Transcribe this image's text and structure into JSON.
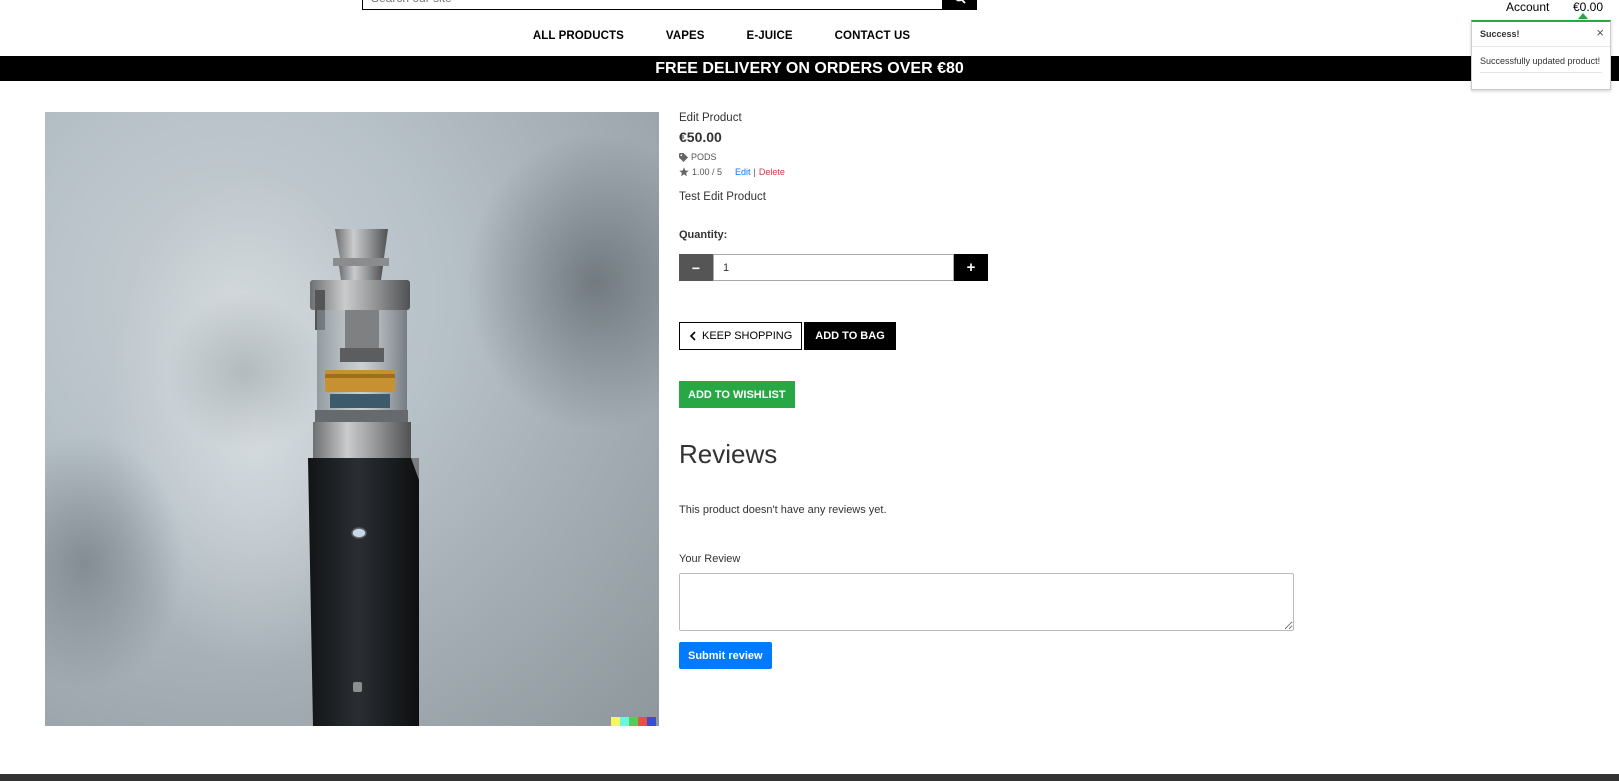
{
  "header": {
    "search_placeholder": "Search our site",
    "account_label": "Account",
    "cart_total": "€0.00"
  },
  "nav": {
    "items": [
      {
        "label": "ALL PRODUCTS"
      },
      {
        "label": "VAPES"
      },
      {
        "label": "E-JUICE"
      },
      {
        "label": "CONTACT US"
      }
    ]
  },
  "banner": {
    "text": "FREE DELIVERY ON ORDERS OVER €80"
  },
  "toast": {
    "title": "Success!",
    "close": "×",
    "message": "Successfully updated product!",
    "accent_color": "#28a745"
  },
  "product": {
    "name": "Edit Product",
    "price": "€50.00",
    "category": "PODS",
    "rating": "1.00 / 5",
    "edit_label": "Edit",
    "separator": "|",
    "delete_label": "Delete",
    "description": "Test Edit Product"
  },
  "quantity": {
    "label": "Quantity:",
    "value": "1",
    "decrement": "−",
    "increment": "+"
  },
  "actions": {
    "keep_shopping": "KEEP SHOPPING",
    "add_to_bag": "ADD TO BAG",
    "add_to_wishlist": "ADD TO WISHLIST"
  },
  "reviews": {
    "heading": "Reviews",
    "empty_text": "This product doesn't have any reviews yet.",
    "your_review_label": "Your Review",
    "submit_label": "Submit review"
  },
  "colors": {
    "success": "#28a745",
    "primary": "#007bff",
    "danger": "#dc3545",
    "banner_bg": "#000000"
  }
}
